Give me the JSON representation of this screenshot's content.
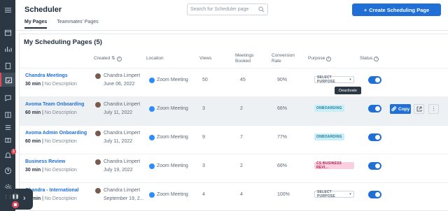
{
  "header": {
    "title": "Scheduler",
    "search_placeholder": "Search for Scheduler page",
    "create_button": "Create Scheduling Page"
  },
  "tabs": [
    {
      "label": "My Pages",
      "active": true
    },
    {
      "label": "Teammates' Pages",
      "active": false
    }
  ],
  "card": {
    "title": "My Scheduling Pages (5)"
  },
  "columns": {
    "created": "Created",
    "location": "Location",
    "views": "Views",
    "meetings_booked": "Meetings Booked",
    "conversion_rate": "Conversion Rate",
    "purpose": "Purpose",
    "status": "Status"
  },
  "rows": [
    {
      "name": "Chandra Meetings",
      "duration": "30 min",
      "desc": "No Description",
      "creator": "Chandra Limpert",
      "date": "June 06, 2022",
      "location": "Zoom Meeting",
      "views": "50",
      "booked": "45",
      "rate": "90%",
      "purpose": "SELECT PURPOSE",
      "purpose_type": "select",
      "status_on": true
    },
    {
      "name": "Avoma Team Onboarding",
      "duration": "60 min",
      "desc": "No Description",
      "creator": "Chandra Limpert",
      "date": "July 11, 2022",
      "location": "Zoom Meeting",
      "views": "3",
      "booked": "2",
      "rate": "66%",
      "purpose": "ONBOARDING",
      "purpose_type": "onboarding",
      "status_on": true
    },
    {
      "name": "Avoma Admin Onboarding",
      "duration": "60 min",
      "desc": "No Description",
      "creator": "Chandra Limpert",
      "date": "July 11, 2022",
      "location": "Zoom Meeting",
      "views": "9",
      "booked": "7",
      "rate": "77%",
      "purpose": "ONBOARDING",
      "purpose_type": "onboarding",
      "status_on": true
    },
    {
      "name": "Business Review",
      "duration": "30 min",
      "desc": "No Description",
      "creator": "Chandra Limpert",
      "date": "July 19, 2022",
      "location": "Zoom Meeting",
      "views": "3",
      "booked": "2",
      "rate": "66%",
      "purpose": "CS BUSINESS REVI...",
      "purpose_type": "business",
      "status_on": true
    },
    {
      "name": "Chandra - International",
      "duration": "30 min",
      "desc": "No Description",
      "creator": "Chandra Limpert",
      "date": "September 19, 2...",
      "location": "Zoom Meeting",
      "views": "4",
      "booked": "4",
      "rate": "100%",
      "purpose": "SELECT PURPOSE",
      "purpose_type": "select",
      "status_on": true
    }
  ],
  "row_actions": {
    "copy_label": "Copy",
    "tooltip": "Deactivate"
  },
  "sidebar": {
    "notification_count": "1"
  },
  "colors": {
    "accent": "#1f6fd6",
    "sidebar": "#2b3743",
    "danger": "#e14a59"
  }
}
